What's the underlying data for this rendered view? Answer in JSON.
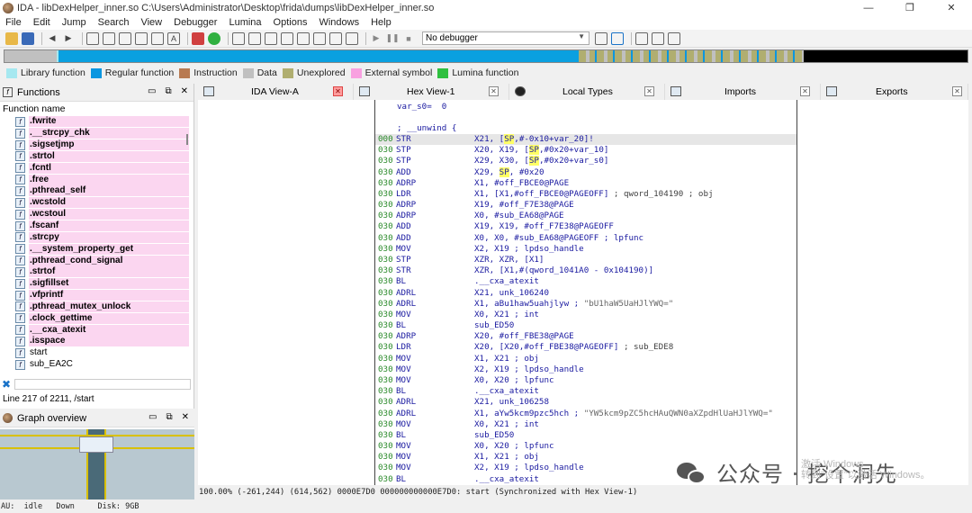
{
  "window": {
    "title": "IDA - libDexHelper_inner.so C:\\Users\\Administrator\\Desktop\\frida\\dumps\\libDexHelper_inner.so",
    "minimize": "—",
    "restore": "❐",
    "close": "✕"
  },
  "menu": [
    "File",
    "Edit",
    "Jump",
    "Search",
    "View",
    "Debugger",
    "Lumina",
    "Options",
    "Windows",
    "Help"
  ],
  "toolbar": {
    "debugger_select": "No debugger"
  },
  "legend": [
    {
      "label": "Library function",
      "color": "#a6e8f0"
    },
    {
      "label": "Regular function",
      "color": "#0a96e0"
    },
    {
      "label": "Instruction",
      "color": "#b87a52"
    },
    {
      "label": "Data",
      "color": "#c0c0c0"
    },
    {
      "label": "Unexplored",
      "color": "#b0ae70"
    },
    {
      "label": "External symbol",
      "color": "#f8a0e0"
    },
    {
      "label": "Lumina function",
      "color": "#30c040"
    }
  ],
  "functions_panel": {
    "title": "Functions",
    "column_header": "Function name",
    "items": [
      ".fwrite",
      ".__strcpy_chk",
      ".sigsetjmp",
      ".strtol",
      ".fcntl",
      ".free",
      ".pthread_self",
      ".wcstold",
      ".wcstoul",
      ".fscanf",
      ".strcpy",
      ".__system_property_get",
      ".pthread_cond_signal",
      ".strtof",
      ".sigfillset",
      ".vfprintf",
      ".pthread_mutex_unlock",
      ".clock_gettime",
      ".__cxa_atexit",
      ".isspace",
      "start",
      "sub_EA2C"
    ],
    "status": "Line 217 of 2211, /start"
  },
  "graph_panel": {
    "title": "Graph overview"
  },
  "tabs": [
    {
      "label": "IDA View-A",
      "close": "✕",
      "active": true
    },
    {
      "label": "Hex View-1",
      "close": "✕"
    },
    {
      "label": "Local Types",
      "close": "✕"
    },
    {
      "label": "Imports",
      "close": "✕"
    },
    {
      "label": "Exports",
      "close": "✕"
    }
  ],
  "disasm": {
    "var_line": "var_s0=  0",
    "unwind_line": "; __unwind {",
    "lines": [
      {
        "addr": "000",
        "mnem": "STR",
        "ops_html": "X21, [<span class=\"sp\">SP</span>,#-0x10+var_20]!"
      },
      {
        "addr": "030",
        "mnem": "STP",
        "ops_html": "X20, X19, [<span class=\"sp\">SP</span>,#0x20+var_10]"
      },
      {
        "addr": "030",
        "mnem": "STP",
        "ops_html": "X29, X30, [<span class=\"sp\">SP</span>,#0x20+var_s0]"
      },
      {
        "addr": "030",
        "mnem": "ADD",
        "ops_html": "X29, <span class=\"sp\">SP</span>, #0x20"
      },
      {
        "addr": "030",
        "mnem": "ADRP",
        "ops_html": "X1, #off_FBCE0@PAGE"
      },
      {
        "addr": "030",
        "mnem": "LDR",
        "ops_html": "X1, [X1,#off_FBCE0@PAGEOFF] <span class=\"cmt\">; qword_104190 ; obj</span>"
      },
      {
        "addr": "030",
        "mnem": "ADRP",
        "ops_html": "X19, #off_F7E38@PAGE"
      },
      {
        "addr": "030",
        "mnem": "ADRP",
        "ops_html": "X0, #sub_EA68@PAGE"
      },
      {
        "addr": "030",
        "mnem": "ADD",
        "ops_html": "X19, X19, #off_F7E38@PAGEOFF"
      },
      {
        "addr": "030",
        "mnem": "ADD",
        "ops_html": "X0, X0, #sub_EA68@PAGEOFF ; lpfunc"
      },
      {
        "addr": "030",
        "mnem": "MOV",
        "ops_html": "X2, X19 ; lpdso_handle"
      },
      {
        "addr": "030",
        "mnem": "STP",
        "ops_html": "XZR, XZR, [X1]"
      },
      {
        "addr": "030",
        "mnem": "STR",
        "ops_html": "XZR, [X1,#(qword_1041A0 - 0x104190)]"
      },
      {
        "addr": "030",
        "mnem": "BL",
        "ops_html": ".__cxa_atexit"
      },
      {
        "addr": "030",
        "mnem": "ADRL",
        "ops_html": "X21, unk_106240"
      },
      {
        "addr": "030",
        "mnem": "ADRL",
        "ops_html": "X1, aBu1haw5uahjlyw ; <span class=\"str\">\"bU1haW5UaHJlYWQ=\"</span>"
      },
      {
        "addr": "030",
        "mnem": "MOV",
        "ops_html": "X0, X21 ; int"
      },
      {
        "addr": "030",
        "mnem": "BL",
        "ops_html": "sub_ED50"
      },
      {
        "addr": "030",
        "mnem": "ADRP",
        "ops_html": "X20, #off_FBE38@PAGE"
      },
      {
        "addr": "030",
        "mnem": "LDR",
        "ops_html": "X20, [X20,#off_FBE38@PAGEOFF] <span class=\"cmt\">; sub_EDE8</span>"
      },
      {
        "addr": "030",
        "mnem": "MOV",
        "ops_html": "X1, X21 ; obj"
      },
      {
        "addr": "030",
        "mnem": "MOV",
        "ops_html": "X2, X19 ; lpdso_handle"
      },
      {
        "addr": "030",
        "mnem": "MOV",
        "ops_html": "X0, X20 ; lpfunc"
      },
      {
        "addr": "030",
        "mnem": "BL",
        "ops_html": ".__cxa_atexit"
      },
      {
        "addr": "030",
        "mnem": "ADRL",
        "ops_html": "X21, unk_106258"
      },
      {
        "addr": "030",
        "mnem": "ADRL",
        "ops_html": "X1, aYw5kcm9pzc5hch ; <span class=\"str\">\"YW5kcm9pZC5hcHAuQWN0aXZpdHlUaHJlYWQ=\"</span>"
      },
      {
        "addr": "030",
        "mnem": "MOV",
        "ops_html": "X0, X21 ; int"
      },
      {
        "addr": "030",
        "mnem": "BL",
        "ops_html": "sub_ED50"
      },
      {
        "addr": "030",
        "mnem": "MOV",
        "ops_html": "X0, X20 ; lpfunc"
      },
      {
        "addr": "030",
        "mnem": "MOV",
        "ops_html": "X1, X21 ; obj"
      },
      {
        "addr": "030",
        "mnem": "MOV",
        "ops_html": "X2, X19 ; lpdso_handle"
      },
      {
        "addr": "030",
        "mnem": "BL",
        "ops_html": ".__cxa_atexit"
      }
    ]
  },
  "status_line": "100.00% (-261,244) (614,562) 0000E7D0 000000000000E7D0: start (Synchronized with Hex View-1)",
  "statusbar": "AU:  idle   Down     Disk: 9GB",
  "watermark": {
    "text": "公众号 · 挖个洞先",
    "overlay": "激活 Windows\n转到\"设置\"以激活 Windows。"
  },
  "colors": {
    "nav_band": "#0aa0e0",
    "external_symbol_row": "#fbd6f0",
    "address": "#2a8a2a",
    "instruction": "#1a1aa0",
    "sp_highlight": "#ffff66"
  }
}
